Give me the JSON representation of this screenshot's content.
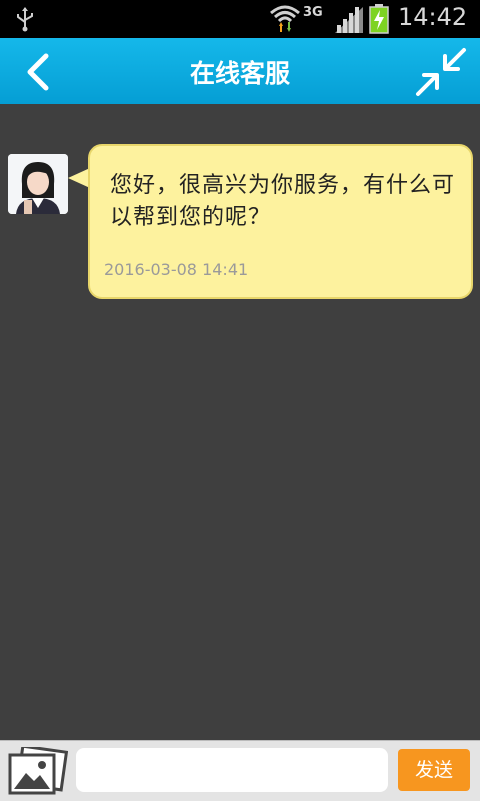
{
  "status_bar": {
    "network": "3G",
    "time": "14:42"
  },
  "header": {
    "title": "在线客服",
    "back_icon": "chevron-left-icon",
    "collapse_icon": "collapse-arrows-icon"
  },
  "messages": [
    {
      "sender": "customer-service",
      "text": "您好，很高兴为你服务，有什么可以帮到您的呢？",
      "timestamp": "2016-03-08 14:41"
    }
  ],
  "composer": {
    "input_value": "",
    "send_label": "发送",
    "image_icon": "image-picker-icon"
  },
  "colors": {
    "header": "#0aa8de",
    "bubble": "#fdf29e",
    "send_button": "#f7961f",
    "background": "#3f3f3f"
  }
}
